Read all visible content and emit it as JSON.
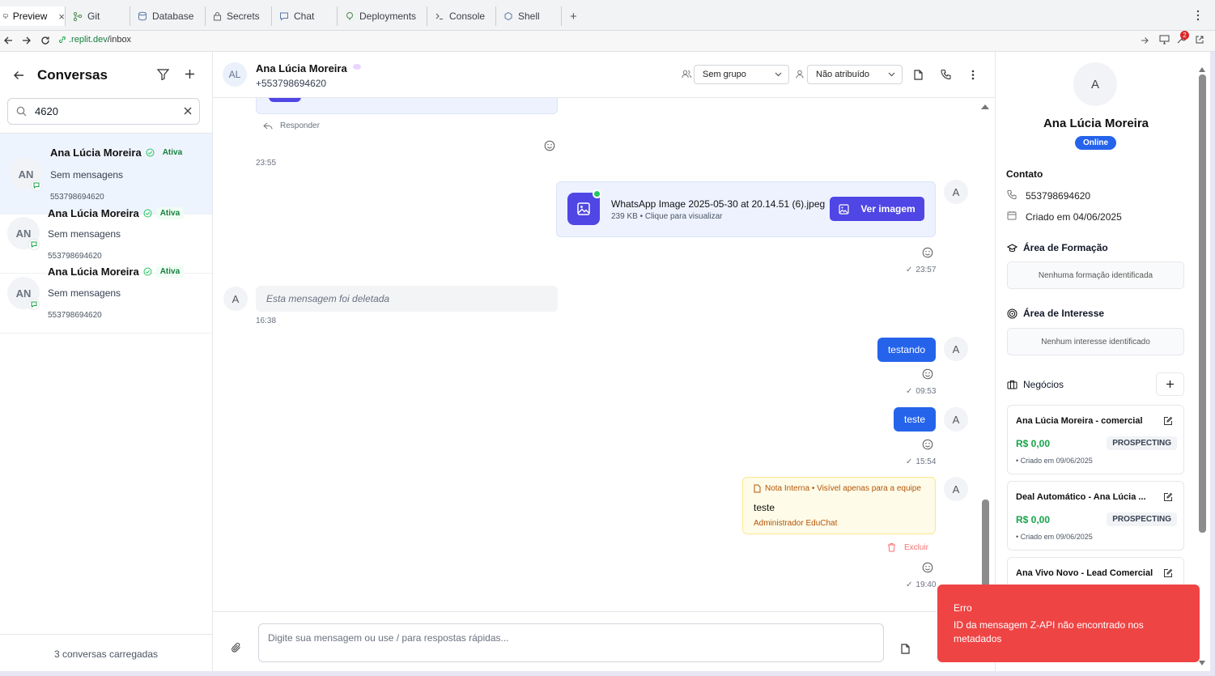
{
  "replit": {
    "tabs": [
      {
        "label": "Preview",
        "icon": "monitor-icon"
      },
      {
        "label": "Git",
        "icon": "git-icon"
      },
      {
        "label": "Database",
        "icon": "database-icon"
      },
      {
        "label": "Secrets",
        "icon": "lock-icon"
      },
      {
        "label": "Chat",
        "icon": "chat-icon"
      },
      {
        "label": "Deployments",
        "icon": "deploy-icon"
      },
      {
        "label": "Console",
        "icon": "console-icon"
      },
      {
        "label": "Shell",
        "icon": "shell-icon"
      }
    ],
    "close": "×",
    "plus": "+",
    "url_host": ".replit.dev",
    "url_path": "/inbox",
    "notify_count": "2"
  },
  "sidebar": {
    "title": "Conversas",
    "search_value": "4620",
    "footer": "3 conversas carregadas",
    "conversations": [
      {
        "initials": "AN",
        "name": "Ana Lúcia Moreira",
        "status": "Ativa",
        "preview": "Sem mensagens",
        "phone": "553798694620"
      },
      {
        "initials": "AN",
        "name": "Ana Lúcia Moreira",
        "status": "Ativa",
        "preview": "Sem mensagens",
        "phone": "553798694620"
      },
      {
        "initials": "AN",
        "name": "Ana Lúcia Moreira",
        "status": "Ativa",
        "preview": "Sem mensagens",
        "phone": "553798694620"
      }
    ]
  },
  "chat": {
    "header": {
      "initials": "AL",
      "name": "Ana Lúcia Moreira",
      "phone": "+553798694620",
      "group": "Sem grupo",
      "assignee": "Não atribuído"
    },
    "reply_label": "Responder",
    "times": {
      "t1": "23:55",
      "t2": "23:57",
      "t3": "16:38",
      "t4": "09:53",
      "t5": "15:54",
      "t6": "19:40"
    },
    "image_msg": {
      "filename": "WhatsApp Image 2025-05-30 at 20.14.51 (6).jpeg",
      "meta": "239 KB • Clique para visualizar",
      "button": "Ver imagem"
    },
    "deleted_msg": "Esta mensagem foi deletada",
    "msg_testando": "testando",
    "msg_teste": "teste",
    "note": {
      "header": "Nota Interna • Visível apenas para a equipe",
      "text": "teste",
      "author": "Administrador EduChat"
    },
    "delete_label": "Excluir",
    "contact_initial": "A",
    "input_placeholder": "Digite sua mensagem ou use / para respostas rápidas..."
  },
  "contact": {
    "initial": "A",
    "name": "Ana Lúcia Moreira",
    "status": "Online",
    "section_contact": "Contato",
    "phone": "553798694620",
    "created": "Criado em 04/06/2025",
    "formacao_title": "Área de Formação",
    "formacao_empty": "Nenhuma formação identificada",
    "interesse_title": "Área de Interesse",
    "interesse_empty": "Nenhum interesse identificado",
    "negocios_title": "Negócios",
    "deals": [
      {
        "title": "Ana Lúcia Moreira - comercial",
        "value": "R$ 0,00",
        "stage": "PROSPECTING",
        "created": "• Criado em 09/06/2025"
      },
      {
        "title": "Deal Automático - Ana Lúcia ...",
        "value": "R$ 0,00",
        "stage": "PROSPECTING",
        "created": "• Criado em 09/06/2025"
      },
      {
        "title": "Ana Vivo Novo - Lead Comercial",
        "value": "",
        "stage": "",
        "created": ""
      }
    ]
  },
  "toast": {
    "title": "Erro",
    "message": "ID da mensagem Z-API não encontrado nos metadados"
  },
  "colors": {
    "primary": "#2563eb",
    "success": "#16a34a",
    "danger": "#ef4444",
    "note_bg": "#fefce8",
    "note_border": "#fde68a"
  }
}
